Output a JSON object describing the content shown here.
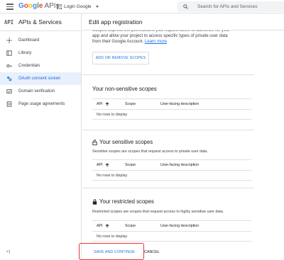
{
  "topbar": {
    "logo_google": [
      "G",
      "o",
      "o",
      "g",
      "l",
      "e"
    ],
    "logo_apis": "APIs",
    "project": "Login Google",
    "search_placeholder": "Search for APIs and Services"
  },
  "sidebar": {
    "mark": "API",
    "title": "APIs & Services",
    "items": [
      {
        "label": "Dashboard",
        "icon": "dashboard-icon"
      },
      {
        "label": "Library",
        "icon": "library-icon"
      },
      {
        "label": "Credentials",
        "icon": "key-icon"
      },
      {
        "label": "OAuth consent screen",
        "icon": "consent-icon",
        "active": true
      },
      {
        "label": "Domain verification",
        "icon": "domain-icon"
      },
      {
        "label": "Page usage agreements",
        "icon": "agreements-icon"
      }
    ],
    "collapse": "<|"
  },
  "main": {
    "title": "Edit app registration",
    "intro_line_cut": "Scopes express the permissions you request users to authorize for your",
    "intro_line2": "app and allow your project to access specific types of private user data",
    "intro_line3": "from their Google Account.",
    "learn_more": "Learn more",
    "add_remove": "ADD OR REMOVE SCOPES"
  },
  "sections": {
    "nonsensitive": {
      "title": "Your non-sensitive scopes",
      "headers": {
        "api": "API",
        "scope": "Scope",
        "desc": "User-facing description"
      },
      "empty": "No rows to display"
    },
    "sensitive": {
      "title": "Your sensitive scopes",
      "desc": "Sensitive scopes are scopes that request access to private user data.",
      "headers": {
        "api": "API",
        "scope": "Scope",
        "desc": "User-facing description"
      },
      "empty": "No rows to display"
    },
    "restricted": {
      "title": "Your restricted scopes",
      "desc": "Restricted scopes are scopes that request access to highly sensitive user data.",
      "headers": {
        "api": "API",
        "scope": "Scope",
        "desc": "User-facing description"
      },
      "empty": "No rows to display"
    }
  },
  "footer": {
    "save": "SAVE AND CONTINUE",
    "cancel": "CANCEL"
  },
  "colors": {
    "accent": "#1a73e8",
    "active_bg": "#e8f0fe",
    "highlight": "#e53935"
  }
}
